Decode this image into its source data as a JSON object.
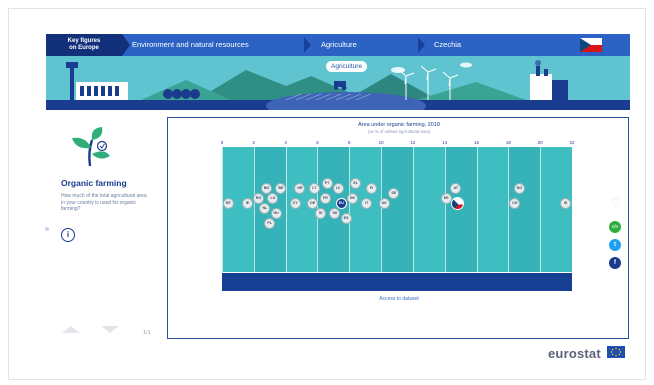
{
  "breadcrumb": {
    "logo_line1": "Key figures",
    "logo_line2": "on Europe",
    "items": [
      {
        "label": "Environment and natural resources"
      },
      {
        "label": "Agriculture"
      },
      {
        "label": "Czechia"
      }
    ]
  },
  "banner": {
    "label": "Agriculture"
  },
  "topic": {
    "title": "Organic farming",
    "description": "How much of the total agricultural area in your country is used for organic farming?",
    "page": "1/1"
  },
  "chart_data": {
    "type": "scatter",
    "title": "Area under organic farming, 2018",
    "subtitle": "(as % of utilised agricultural area)",
    "x_ticks": [
      "0",
      "2",
      "4",
      "6",
      "8",
      "10",
      "12",
      "14",
      "16",
      "18",
      "20",
      "22"
    ],
    "xlim": [
      0,
      22
    ],
    "selected": "Czechia",
    "points": [
      {
        "code": "EU",
        "x": 7.5
      },
      {
        "code": "CZ",
        "x": 14.8
      },
      {
        "code": "MT",
        "x": 0.4
      },
      {
        "code": "IE",
        "x": 1.6
      },
      {
        "code": "RO",
        "x": 2.3
      },
      {
        "code": "NL",
        "x": 2.7
      },
      {
        "code": "BG",
        "x": 2.8
      },
      {
        "code": "PL",
        "x": 3.0
      },
      {
        "code": "LU",
        "x": 3.2
      },
      {
        "code": "HU",
        "x": 3.4
      },
      {
        "code": "BE",
        "x": 3.7
      },
      {
        "code": "CY",
        "x": 4.6
      },
      {
        "code": "HR",
        "x": 4.9
      },
      {
        "code": "DE",
        "x": 5.7
      },
      {
        "code": "LT",
        "x": 5.8
      },
      {
        "code": "SI",
        "x": 6.2
      },
      {
        "code": "FR",
        "x": 6.5
      },
      {
        "code": "PT",
        "x": 6.6
      },
      {
        "code": "SK",
        "x": 7.1
      },
      {
        "code": "LV",
        "x": 7.3
      },
      {
        "code": "ES",
        "x": 7.8
      },
      {
        "code": "DK",
        "x": 8.2
      },
      {
        "code": "EL",
        "x": 8.4
      },
      {
        "code": "IT",
        "x": 9.1
      },
      {
        "code": "FI",
        "x": 9.4
      },
      {
        "code": "UK",
        "x": 10.2
      },
      {
        "code": "SE",
        "x": 10.8
      },
      {
        "code": "EE",
        "x": 14.1
      },
      {
        "code": "AT",
        "x": 14.7
      },
      {
        "code": "CH",
        "x": 18.4
      },
      {
        "code": "NO",
        "x": 18.7
      },
      {
        "code": "IS",
        "x": 21.6
      }
    ]
  },
  "chart_footer": {
    "link": "Access to dataset"
  },
  "share": {
    "embed_label": "</>",
    "twitter_label": "t",
    "facebook_label": "f"
  },
  "brand": {
    "name": "eurostat"
  },
  "colors": {
    "navy": "#1a3c8f",
    "breadcrumb_blue": "#2b62c4",
    "plot_teal": "#3bb9bd",
    "banner_teal": "#5fc4cf"
  }
}
